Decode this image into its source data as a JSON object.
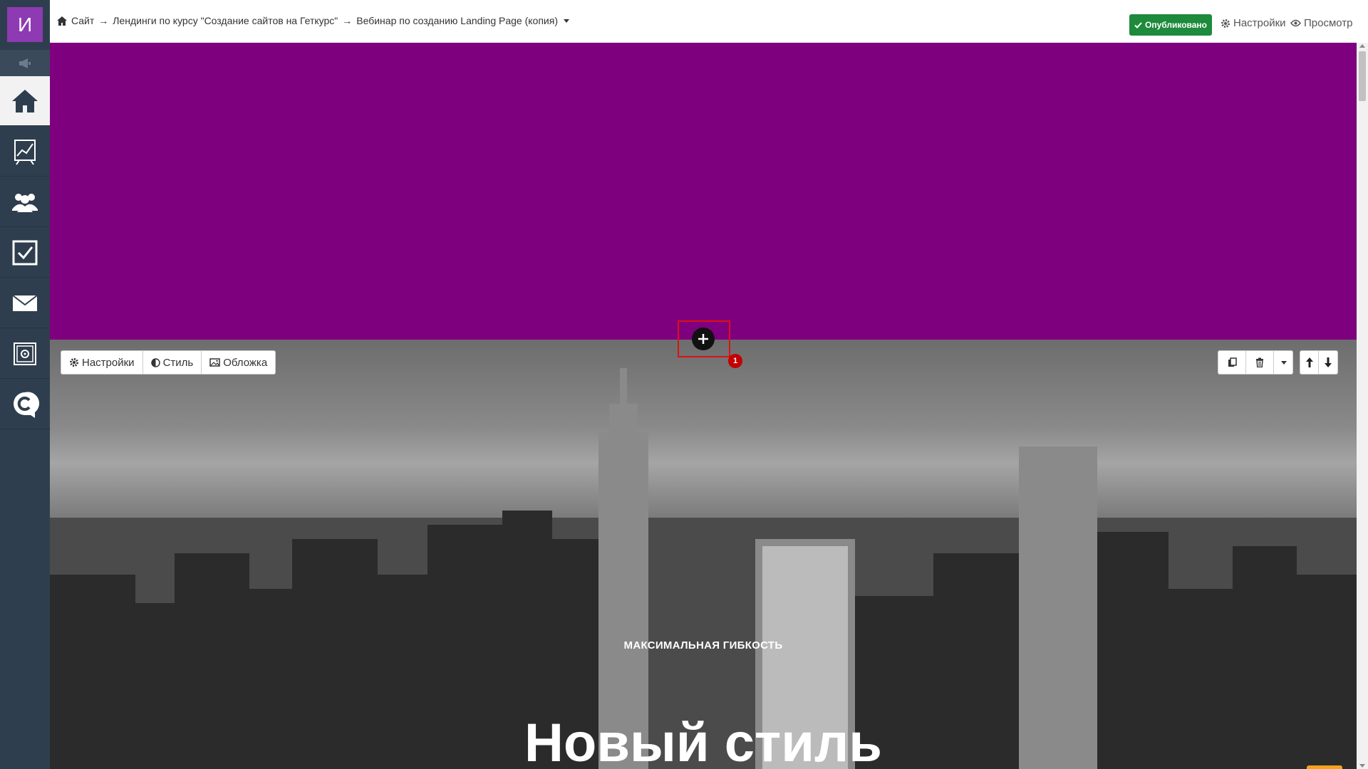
{
  "sidebar": {
    "avatar_letter": "И",
    "items": [
      {
        "name": "home-icon",
        "active": true
      },
      {
        "name": "chart-icon",
        "active": false
      },
      {
        "name": "users-icon",
        "active": false
      },
      {
        "name": "tasks-icon",
        "active": false
      },
      {
        "name": "mail-icon",
        "active": false
      },
      {
        "name": "safe-icon",
        "active": false
      },
      {
        "name": "chat-c-icon",
        "active": false
      }
    ]
  },
  "topbar": {
    "breadcrumb": {
      "site": "Сайт",
      "separator": "→",
      "section": "Лендинги по курсу \"Создание сайтов на Геткурс\"",
      "page": "Вебинар по созданию Landing Page (копия)"
    },
    "published_label": "Опубликовано",
    "settings_label": "Настройки",
    "preview_label": "Просмотр"
  },
  "canvas": {
    "top_block_color": "#7f007f",
    "add_badge_count": "1",
    "block_toolbar": {
      "settings_label": "Настройки",
      "style_label": "Стиль",
      "cover_label": "Обложка"
    },
    "hero": {
      "kicker": "МАКСИМАЛЬНАЯ ГИБКОСТЬ",
      "title": "Новый стиль"
    }
  },
  "colors": {
    "sidebar": "#2f3e4e",
    "accent_purple": "#8e3ab3",
    "published_green": "#1e8a3c",
    "scroll_top_orange": "#f7a21b",
    "chat_blue": "#1f5c8f"
  }
}
